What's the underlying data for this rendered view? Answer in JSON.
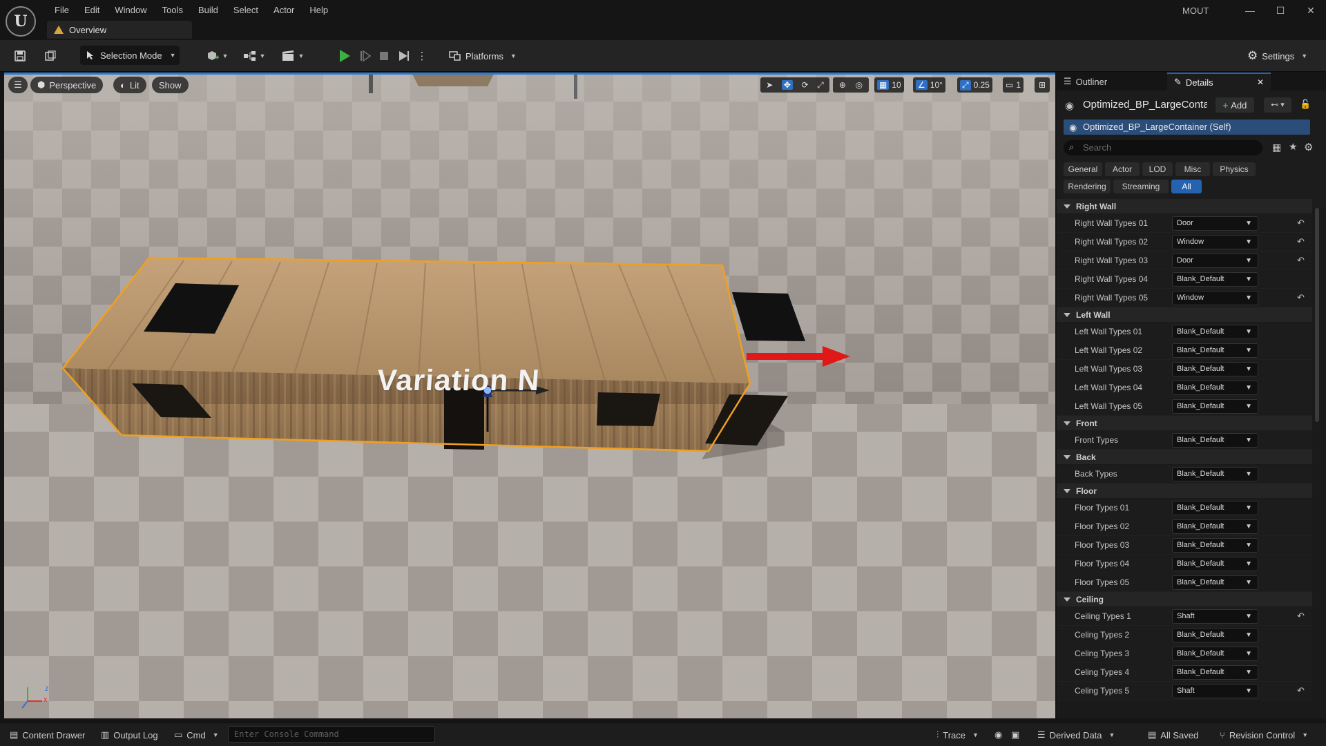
{
  "app": {
    "project": "MOUT",
    "tab": "Overview",
    "menu": [
      "File",
      "Edit",
      "Window",
      "Tools",
      "Build",
      "Select",
      "Actor",
      "Help"
    ]
  },
  "toolbar": {
    "selection_mode": "Selection Mode",
    "platforms": "Platforms",
    "settings": "Settings"
  },
  "viewport": {
    "perspective": "Perspective",
    "lit": "Lit",
    "show": "Show",
    "grid_snap": "10",
    "rotation_snap": "10°",
    "scale_snap": "0.25",
    "camera_speed": "1",
    "scene_text": "Variation N",
    "axis_x": "x",
    "axis_z": "z"
  },
  "panel": {
    "outliner_tab": "Outliner",
    "details_tab": "Details",
    "actor_name": "Optimized_BP_LargeConta",
    "add_label": "Add",
    "self_row": "Optimized_BP_LargeContainer (Self)",
    "search_placeholder": "Search",
    "filters_row1": [
      "General",
      "Actor",
      "LOD",
      "Misc",
      "Physics"
    ],
    "filters_row2": [
      "Rendering",
      "Streaming",
      "All"
    ]
  },
  "categories": [
    {
      "name": "Right Wall",
      "rows": [
        {
          "label": "Right Wall Types 01",
          "value": "Door",
          "reset": true
        },
        {
          "label": "Right Wall Types 02",
          "value": "Window",
          "reset": true
        },
        {
          "label": "Right Wall Types 03",
          "value": "Door",
          "reset": true
        },
        {
          "label": "Right Wall Types 04",
          "value": "Blank_Default",
          "reset": false
        },
        {
          "label": "Right Wall Types 05",
          "value": "Window",
          "reset": true
        }
      ]
    },
    {
      "name": "Left Wall",
      "rows": [
        {
          "label": "Left Wall Types 01",
          "value": "Blank_Default",
          "reset": false
        },
        {
          "label": "Left Wall Types 02",
          "value": "Blank_Default",
          "reset": false
        },
        {
          "label": "Left Wall Types 03",
          "value": "Blank_Default",
          "reset": false
        },
        {
          "label": "Left Wall Types 04",
          "value": "Blank_Default",
          "reset": false
        },
        {
          "label": "Left Wall Types 05",
          "value": "Blank_Default",
          "reset": false
        }
      ]
    },
    {
      "name": "Front",
      "rows": [
        {
          "label": "Front Types",
          "value": "Blank_Default",
          "reset": false
        }
      ]
    },
    {
      "name": "Back",
      "rows": [
        {
          "label": "Back Types",
          "value": "Blank_Default",
          "reset": false
        }
      ]
    },
    {
      "name": "Floor",
      "rows": [
        {
          "label": "Floor Types 01",
          "value": "Blank_Default",
          "reset": false
        },
        {
          "label": "Floor Types 02",
          "value": "Blank_Default",
          "reset": false
        },
        {
          "label": "Floor Types 03",
          "value": "Blank_Default",
          "reset": false
        },
        {
          "label": "Floor Types 04",
          "value": "Blank_Default",
          "reset": false
        },
        {
          "label": "Floor Types 05",
          "value": "Blank_Default",
          "reset": false
        }
      ]
    },
    {
      "name": "Ceiling",
      "rows": [
        {
          "label": "Ceiling Types 1",
          "value": "Shaft",
          "reset": true
        },
        {
          "label": "Celing Types 2",
          "value": "Blank_Default",
          "reset": false
        },
        {
          "label": "Celing Types 3",
          "value": "Blank_Default",
          "reset": false
        },
        {
          "label": "Celing Types 4",
          "value": "Blank_Default",
          "reset": false
        },
        {
          "label": "Celing Types 5",
          "value": "Shaft",
          "reset": true
        }
      ]
    }
  ],
  "status": {
    "content_drawer": "Content Drawer",
    "output_log": "Output Log",
    "cmd": "Cmd",
    "console_placeholder": "Enter Console Command",
    "trace": "Trace",
    "derived_data": "Derived Data",
    "all_saved": "All Saved",
    "revision_control": "Revision Control"
  },
  "colors": {
    "accent": "#2563b0",
    "selection_outline": "#f0a020",
    "play_green": "#3cb043",
    "gizmo_red": "#e01818"
  }
}
